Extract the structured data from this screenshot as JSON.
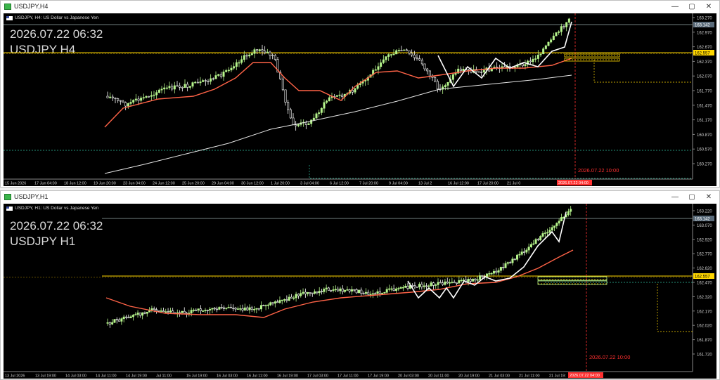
{
  "windows": [
    {
      "title": "USDJPY,H4",
      "symbol_caption": "USDJPY, H4: US Dollar vs Japanese Yen",
      "overlay_time": "2026.07.22 06:32",
      "overlay_symbol": "USDJPY H4",
      "price_labels": [
        "163.270",
        "162.970",
        "162.670",
        "162.370",
        "162.070",
        "161.770",
        "161.470",
        "161.170",
        "160.870",
        "160.570",
        "160.270"
      ],
      "current_price_tag": "163.142",
      "level_tag": "162.557",
      "time_labels": [
        "15 Jun 2026",
        "17 Jun 04:00",
        "18 Jun 12:00",
        "19 Jun 20:00",
        "23 Jun 04:00",
        "24 Jun 12:00",
        "25 Jun 20:00",
        "29 Jun 04:00",
        "30 Jun 12:00",
        "1 Jul 20:00",
        "3 Jul 04:00",
        "6 Jul 12:00",
        "7 Jul 20:00",
        "9 Jul 04:00",
        "13 Jul 2",
        "16 Jul 12:00",
        "17 Jul 20:00",
        "21 Jul 0"
      ],
      "time_highlight": "2026.07.22 04:00",
      "future_label": "2026.07.22 10:00",
      "colors": {
        "bull": "#b6f58c",
        "bear": "#ffffff",
        "ma_fast": "#ff6347",
        "ma_slow": "#e6e6e6",
        "level": "#ffd700",
        "grid_dot": "#2fbfa0",
        "cursor": "#ff3030"
      },
      "icons": [
        "chart-window-icon",
        "minimize-icon",
        "maximize-icon",
        "close-icon"
      ]
    },
    {
      "title": "USDJPY,H1",
      "symbol_caption": "USDJPY, H1: US Dollar vs Japanese Yen",
      "overlay_time": "2026.07.22 06:32",
      "overlay_symbol": "USDJPY H1",
      "price_labels": [
        "163.220",
        "163.070",
        "162.920",
        "162.770",
        "162.620",
        "162.470",
        "162.320",
        "162.170",
        "162.020",
        "161.870",
        "161.720"
      ],
      "current_price_tag": "163.142",
      "level_tag": "162.557",
      "time_labels": [
        "13 Jul 2026",
        "13 Jul 19:00",
        "14 Jul 03:00",
        "14 Jul 11:00",
        "14 Jul 19:00",
        "Jul 11:00",
        "15 Jul 19:00",
        "16 Jul 03:00",
        "16 Jul 11:00",
        "16 Jul 19:00",
        "17 Jul 03:00",
        "17 Jul 11:00",
        "17 Jul 19:00",
        "20 Jul 03:00",
        "20 Jul 11:00",
        "20 Jul 19:00",
        "21 Jul 03:00",
        "21 Jul 11:00",
        "21 Jul 19:"
      ],
      "time_highlight": "2026.07.22 04:00",
      "future_label": "2026.07.22 10:00",
      "colors": {
        "bull": "#b6f58c",
        "bear": "#ffffff",
        "ma_fast": "#ff6347",
        "ma_slow": "#e6e6e6",
        "level": "#ffd700",
        "grid_dot": "#2fbfa0",
        "cursor": "#ff3030"
      },
      "icons": [
        "chart-window-icon",
        "minimize-icon",
        "maximize-icon",
        "close-icon"
      ]
    }
  ]
}
